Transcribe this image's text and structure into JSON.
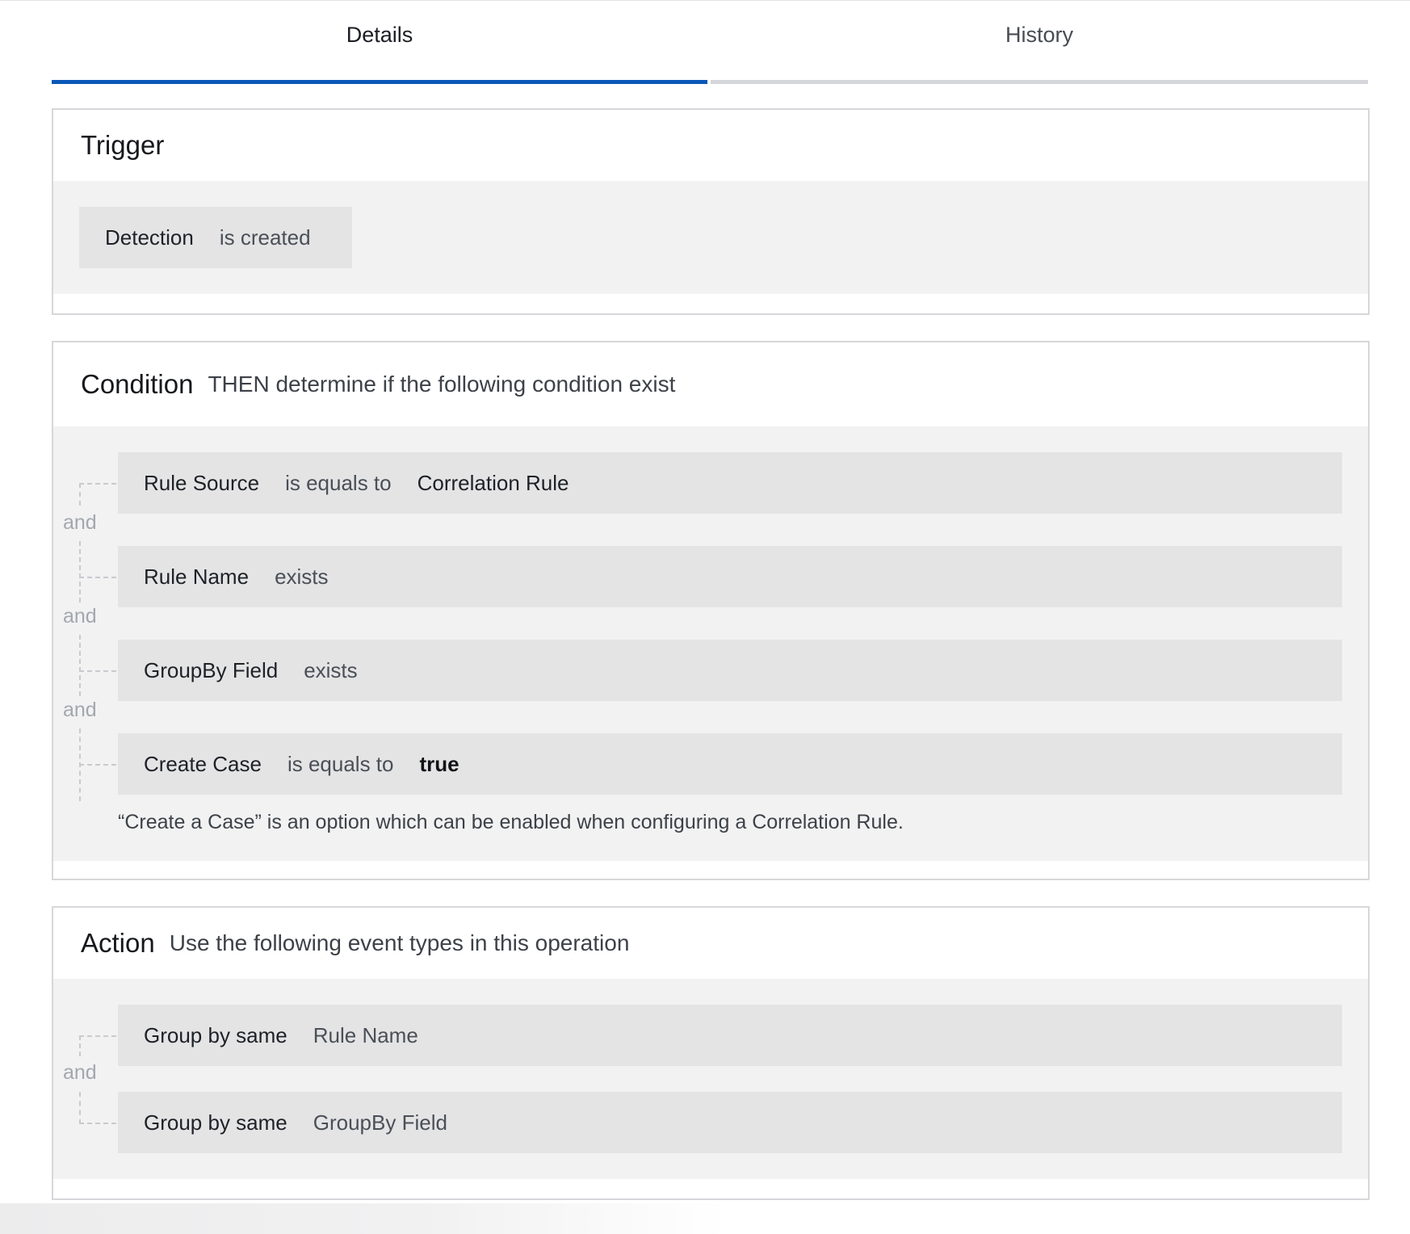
{
  "tabs": {
    "details": "Details",
    "history": "History"
  },
  "trigger": {
    "title": "Trigger",
    "chip": {
      "field": "Detection",
      "op": "is created"
    }
  },
  "condition": {
    "title": "Condition",
    "subtitle": "THEN determine if the following condition exist",
    "rows": [
      {
        "field": "Rule Source",
        "op": "is equals to",
        "value": "Correlation Rule"
      },
      {
        "field": "Rule Name",
        "op": "exists"
      },
      {
        "field": "GroupBy Field",
        "op": "exists"
      },
      {
        "field": "Create Case",
        "op": "is equals to",
        "value": "true"
      }
    ],
    "connector": "and",
    "note": "“Create a Case” is an option which can be enabled when configuring a Correlation Rule."
  },
  "action": {
    "title": "Action",
    "subtitle": "Use the following event types in this operation",
    "rows": [
      {
        "field": "Group by same",
        "value": "Rule Name"
      },
      {
        "field": "Group by same",
        "value": "GroupBy Field"
      }
    ],
    "connector": "and"
  },
  "colors": {
    "active_tab": "#0a57b8",
    "inactive_tab_border": "#d4d6da",
    "panel_bg": "#f2f2f2",
    "chip_bg": "#e4e4e5"
  }
}
